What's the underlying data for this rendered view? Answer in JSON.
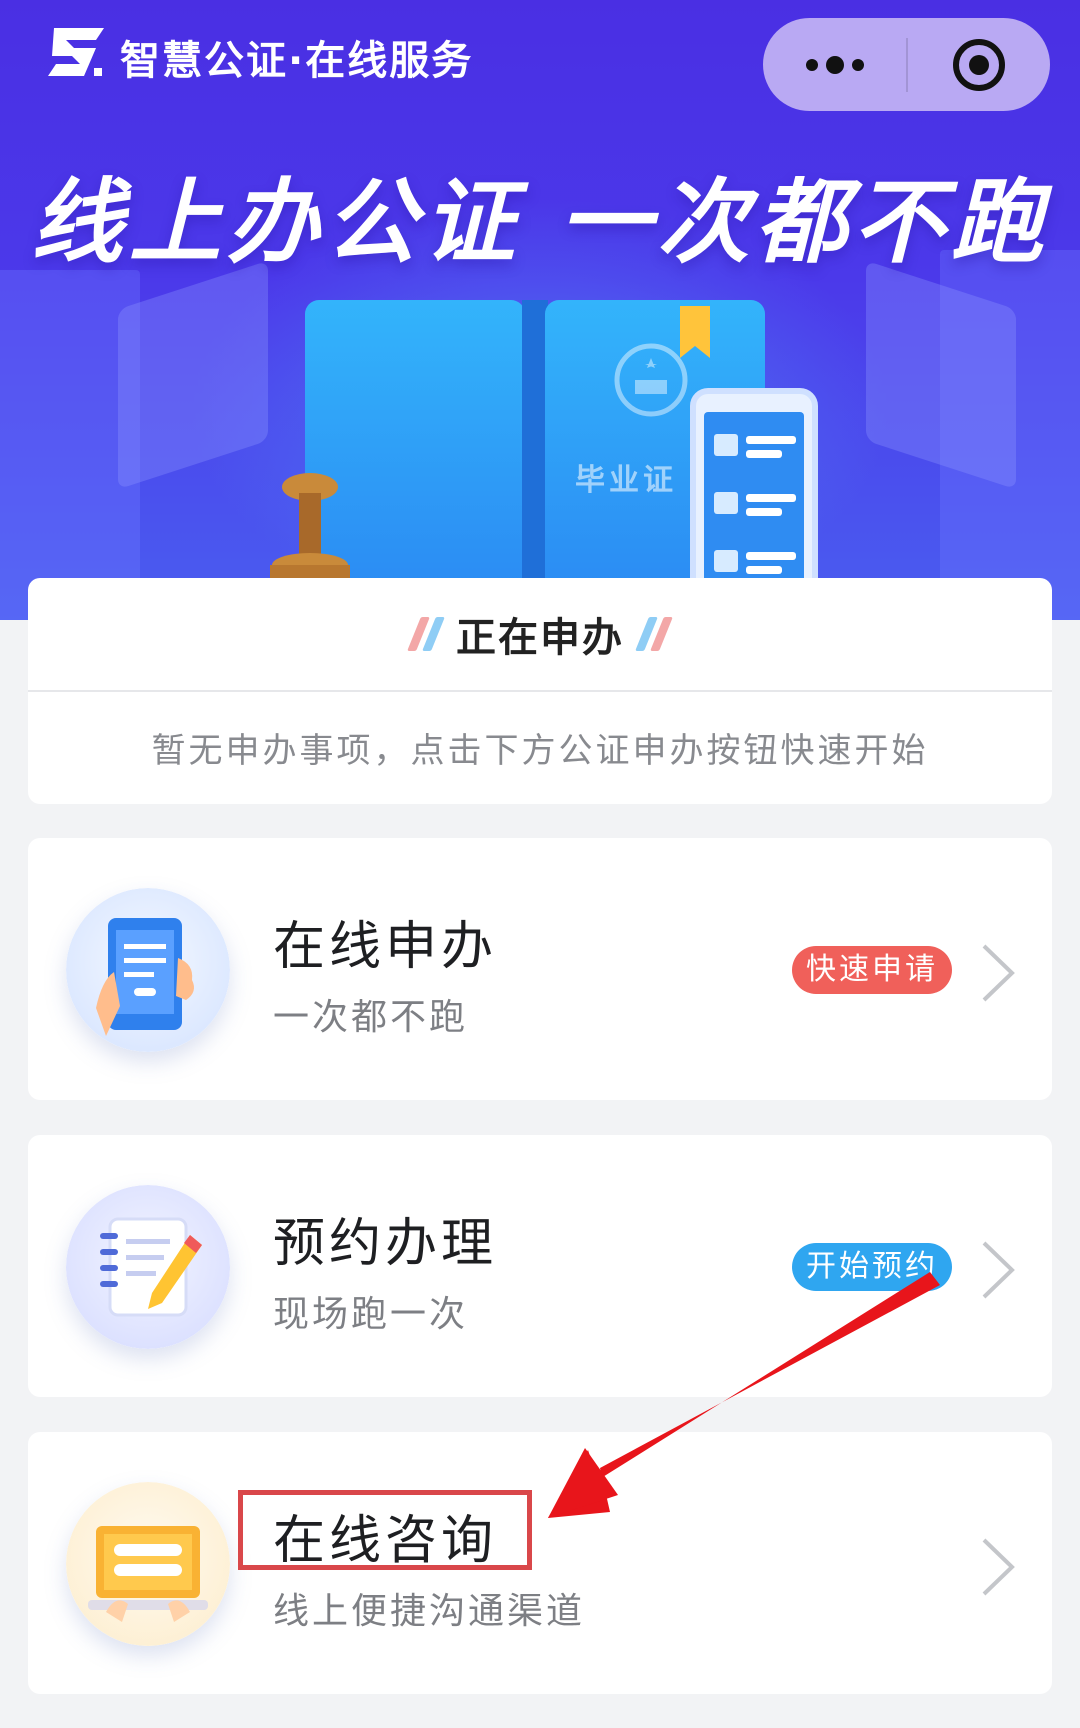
{
  "header": {
    "app_title": "智慧公证·在线服务",
    "capsule_more_icon": "more-dots-icon",
    "capsule_close_icon": "target-circle-icon"
  },
  "banner": {
    "slogan": "线上办公证  一次都不跑",
    "certificate_text": "毕业证"
  },
  "status": {
    "title": "正在申办",
    "empty_message": "暂无申办事项，点击下方公证申办按钮快速开始"
  },
  "services": [
    {
      "title": "在线申办",
      "subtitle": "一次都不跑",
      "tag": "快速申请",
      "tag_color": "#f0605a",
      "icon": "phone-hand-icon"
    },
    {
      "title": "预约办理",
      "subtitle": "现场跑一次",
      "tag": "开始预约",
      "tag_color": "#2fa6f0",
      "icon": "notepad-pencil-icon"
    },
    {
      "title": "在线咨询",
      "subtitle": "线上便捷沟通渠道",
      "tag": "",
      "icon": "laptop-chat-icon"
    }
  ],
  "annotation": {
    "highlight_color": "#d9474a",
    "arrow_color": "#e8151b"
  }
}
